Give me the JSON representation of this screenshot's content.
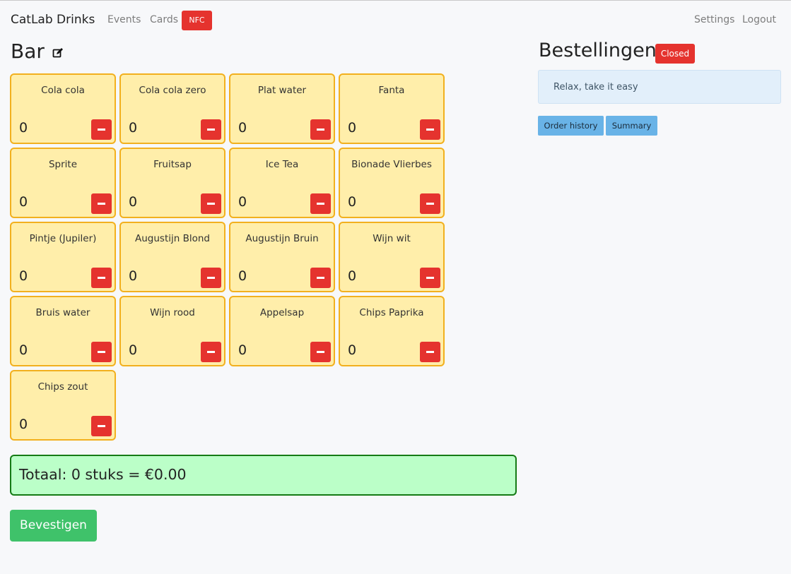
{
  "nav": {
    "brand": "CatLab Drinks",
    "events": "Events",
    "cards": "Cards",
    "nfc": "NFC",
    "settings": "Settings",
    "logout": "Logout"
  },
  "bar": {
    "title": "Bar",
    "products": [
      {
        "name": "Cola cola",
        "count": "0"
      },
      {
        "name": "Cola cola zero",
        "count": "0"
      },
      {
        "name": "Plat water",
        "count": "0"
      },
      {
        "name": "Fanta",
        "count": "0"
      },
      {
        "name": "Sprite",
        "count": "0"
      },
      {
        "name": "Fruitsap",
        "count": "0"
      },
      {
        "name": "Ice Tea",
        "count": "0"
      },
      {
        "name": "Bionade Vlierbes",
        "count": "0"
      },
      {
        "name": "Pintje (Jupiler)",
        "count": "0"
      },
      {
        "name": "Augustijn Blond",
        "count": "0"
      },
      {
        "name": "Augustijn Bruin",
        "count": "0"
      },
      {
        "name": "Wijn wit",
        "count": "0"
      },
      {
        "name": "Bruis water",
        "count": "0"
      },
      {
        "name": "Wijn rood",
        "count": "0"
      },
      {
        "name": "Appelsap",
        "count": "0"
      },
      {
        "name": "Chips Paprika",
        "count": "0"
      },
      {
        "name": "Chips zout",
        "count": "0"
      }
    ],
    "total": "Totaal: 0 stuks = €0.00",
    "confirm": "Bevestigen"
  },
  "orders": {
    "title": "Bestellingen",
    "status": "Closed",
    "message": "Relax, take it easy",
    "history_button": "Order history",
    "summary_button": "Summary"
  },
  "colors": {
    "danger": "#e5332e",
    "card_bg": "#ffeeaa",
    "card_border": "#f2b01e",
    "total_bg": "#bbffc8",
    "success": "#3fc26a",
    "info": "#69b3e7"
  }
}
